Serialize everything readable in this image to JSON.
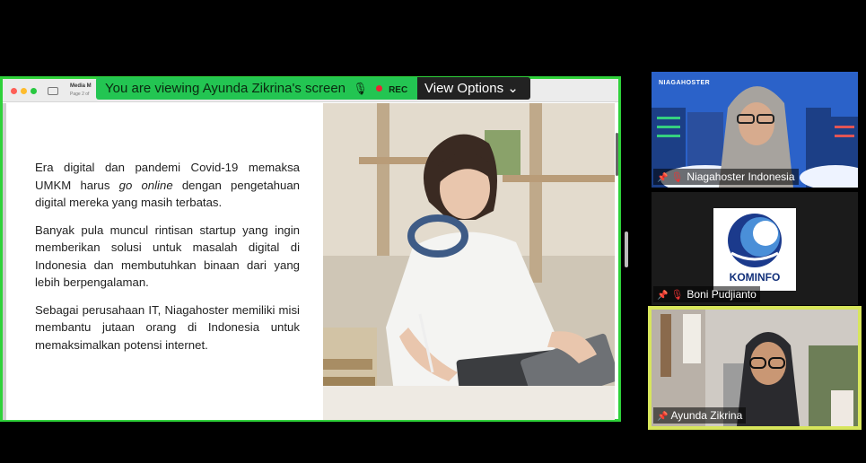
{
  "share_banner": {
    "viewing_text": "You are viewing Ayunda Zikrina's screen",
    "rec_label": "REC",
    "view_options_label": "View Options",
    "view_options_chevron": "⌄"
  },
  "mac_window": {
    "title": "Media M",
    "subtitle": "Page 2 of"
  },
  "slide": {
    "paragraph_1_a": "Era digital dan pandemi Covid-19 memaksa UMKM harus ",
    "paragraph_1_em": "go online",
    "paragraph_1_b": " dengan pengetahuan digital mereka yang masih terbatas.",
    "paragraph_2": "Banyak pula muncul rintisan startup yang ingin memberikan solusi untuk masalah digital di Indonesia dan membutuhkan binaan dari yang lebih berpengalaman.",
    "paragraph_3": "Sebagai perusahaan IT, Niagahoster memiliki misi membantu jutaan orang di Indonesia untuk memaksimalkan potensi internet."
  },
  "participants": [
    {
      "name": "Niagahoster Indonesia",
      "brand": "NIAGAHOSTER",
      "muted": true
    },
    {
      "name": "Boni Pudjianto",
      "logo_text": "KOMINFO",
      "muted": true
    },
    {
      "name": "Ayunda Zikrina",
      "muted": false
    }
  ],
  "colors": {
    "share_border": "#2fd13a",
    "banner_green": "#23c552",
    "active_speaker_border": "#d8e65c",
    "niagahoster_blue": "#2b62c9"
  }
}
